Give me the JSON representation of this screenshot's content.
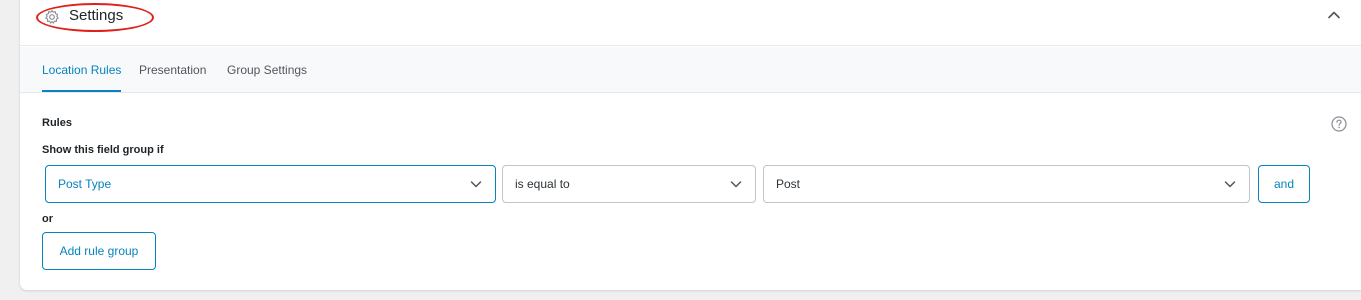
{
  "header": {
    "title": "Settings",
    "icon": "gear-icon",
    "collapse_icon": "chevron-up-icon"
  },
  "tabs": [
    {
      "label": "Location Rules",
      "active": true
    },
    {
      "label": "Presentation",
      "active": false
    },
    {
      "label": "Group Settings",
      "active": false
    }
  ],
  "rules": {
    "label": "Rules",
    "help_icon": "question-circle-icon",
    "show_if": "Show this field group if",
    "row": {
      "param": "Post Type",
      "operator": "is equal to",
      "value": "Post",
      "and_label": "and"
    },
    "or_label": "or",
    "add_group_label": "Add rule group"
  },
  "colors": {
    "accent": "#0783be",
    "highlight_circle": "#e0201b",
    "border": "#c3c4c7"
  }
}
